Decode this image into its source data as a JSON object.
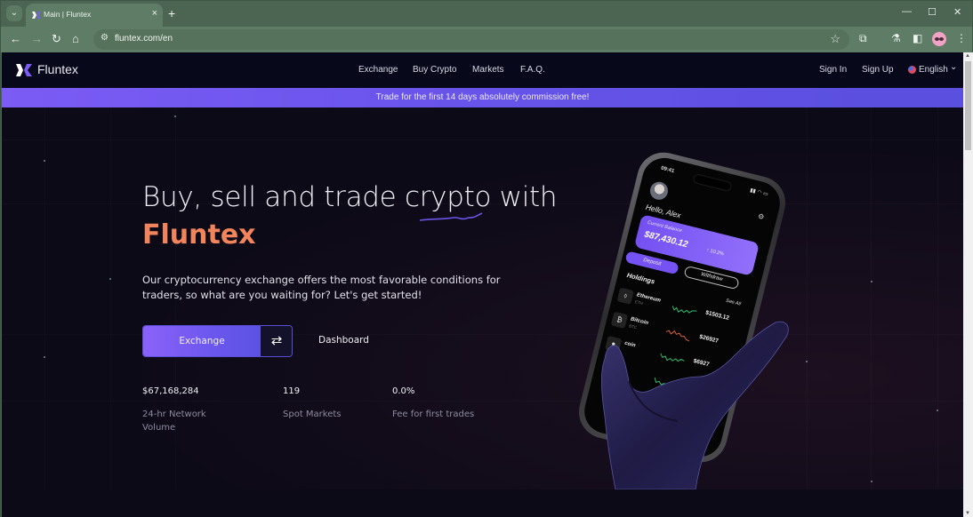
{
  "browser": {
    "tab_title": "Main | Fluntex",
    "tab_close_icon": "×",
    "new_tab_icon": "+",
    "tab_search_icon": "⌄",
    "window_controls": {
      "minimize": "—",
      "maximize": "☐",
      "close": "✕"
    },
    "nav": {
      "back": "←",
      "forward": "→",
      "reload": "↻",
      "home": "⌂"
    },
    "url": "fluntex.com/en",
    "site_info_icon": "⚙",
    "bookmark_icon": "☆",
    "extensions_icon": "⧉",
    "labs_icon": "⚗",
    "sidepanel_icon": "◧",
    "menu_icon": "⋮"
  },
  "site": {
    "brand": "Fluntex",
    "nav_links": [
      "Exchange",
      "Buy Crypto",
      "Markets",
      "F.A.Q."
    ],
    "sign_in": "Sign In",
    "sign_up": "Sign Up",
    "language": "English",
    "language_chevron": "⌄",
    "promo": "Trade for the first 14 days absolutely commission free!",
    "colors": {
      "accent": "#7b5cf5",
      "brand_orange": "#f2845c",
      "background": "#0d0a17"
    }
  },
  "hero": {
    "headline": "Buy, sell and trade crypto with",
    "headline_brand": "Fluntex",
    "subtext": "Our cryptocurrency exchange offers the most favorable conditions for traders, so what are you waiting for? Let's get started!",
    "exchange_button": "Exchange",
    "exchange_icon": "⇄",
    "dashboard_button": "Dashboard",
    "stats": [
      {
        "value": "$67,168,284",
        "label": "24-hr Network Volume"
      },
      {
        "value": "119",
        "label": "Spot Markets"
      },
      {
        "value": "0.0%",
        "label": "Fee for first trades"
      }
    ]
  },
  "phone": {
    "time": "09:41",
    "signal": "▮▮ ◠ ▭",
    "greeting": "Hello, Alex",
    "gear_icon": "⚙",
    "balance_label": "Current Balance",
    "balance": "$87,430.12",
    "balance_change": "↑ 10.2%",
    "deposit": "Deposit",
    "withdraw": "Withdraw",
    "holdings_title": "Holdings",
    "see_all": "See All",
    "holdings": [
      {
        "icon": "⬨",
        "name": "Ethereum",
        "symbol": "ETH",
        "price": "$1503.12",
        "trend": "up"
      },
      {
        "icon": "₿",
        "name": "Bitcoin",
        "symbol": "BTC",
        "price": "$26927",
        "trend": "down"
      },
      {
        "icon": "●",
        "name": "coin",
        "symbol": "",
        "price": "$6927",
        "trend": "up"
      }
    ]
  }
}
